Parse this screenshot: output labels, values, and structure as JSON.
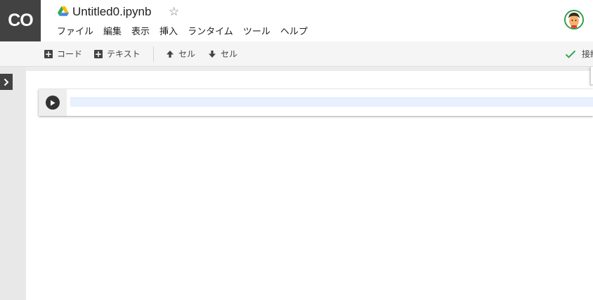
{
  "app": {
    "logo_text": "CO",
    "title": "Untitled0.ipynb",
    "star": "☆"
  },
  "menu": [
    "ファイル",
    "編集",
    "表示",
    "挿入",
    "ランタイム",
    "ツール",
    "ヘルプ"
  ],
  "toolbar": {
    "add_code_label": "コード",
    "add_text_label": "テキスト",
    "cell_up_label": "セル",
    "cell_down_label": "セル",
    "connection_label": "接続"
  },
  "icons": {
    "drive": "google-drive-icon",
    "star": "star-outline-icon",
    "add": "plus-box-icon",
    "up": "arrow-up-icon",
    "down": "arrow-down-icon",
    "check": "check-icon",
    "run": "play-circle-icon",
    "side_toggle": "chevron-right-icon"
  },
  "colors": {
    "logo_bg": "#424242",
    "check": "#34a853",
    "avatar_ring": "#2e9e4f",
    "editor_bg": "#e8f0fe"
  }
}
